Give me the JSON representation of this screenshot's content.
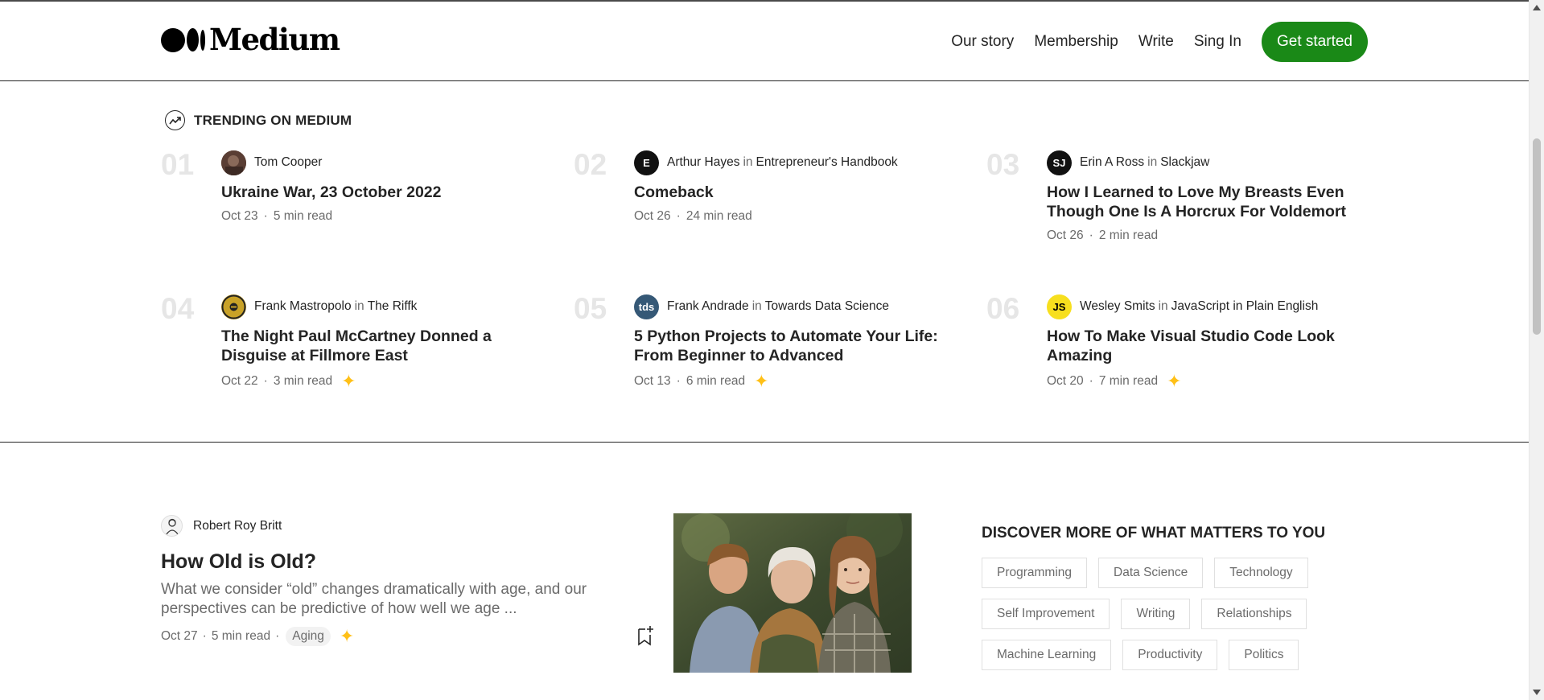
{
  "header": {
    "logo_text": "Medium",
    "nav": [
      "Our story",
      "Membership",
      "Write",
      "Sing In"
    ],
    "cta": "Get started",
    "accent_color": "#1a8917"
  },
  "trending": {
    "heading": "TRENDING ON MEDIUM",
    "items": [
      {
        "num": "01",
        "author": "Tom Cooper",
        "in": "",
        "publication": "",
        "avatar_text": "",
        "avatar_color": "#6b4a3a",
        "title": "Ukraine War, 23 October 2022",
        "date": "Oct 23",
        "read": "5 min read",
        "member_only": false
      },
      {
        "num": "02",
        "author": "Arthur Hayes",
        "in": "in",
        "publication": "Entrepreneur's Handbook",
        "avatar_text": "E",
        "avatar_color": "#111111",
        "title": "Comeback",
        "date": "Oct 26",
        "read": "24 min read",
        "member_only": false
      },
      {
        "num": "03",
        "author": "Erin A Ross",
        "in": "in",
        "publication": "Slackjaw",
        "avatar_text": "SJ",
        "avatar_color": "#111111",
        "title": "How I Learned to Love My Breasts Even Though One Is A Horcrux For Voldemort",
        "date": "Oct 26",
        "read": "2 min read",
        "member_only": false
      },
      {
        "num": "04",
        "author": "Frank Mastropolo",
        "in": "in",
        "publication": "The Riffk",
        "avatar_text": "",
        "avatar_color": "#c9a227",
        "title": "The Night Paul McCartney Donned a Disguise at Fillmore East",
        "date": "Oct 22",
        "read": "3 min read",
        "member_only": true
      },
      {
        "num": "05",
        "author": "Frank Andrade",
        "in": "in",
        "publication": "Towards Data Science",
        "avatar_text": "tds",
        "avatar_color": "#355876",
        "title": "5 Python Projects to Automate Your Life: From Beginner to Advanced",
        "date": "Oct 13",
        "read": "6 min read",
        "member_only": true
      },
      {
        "num": "06",
        "author": "Wesley Smits",
        "in": "in",
        "publication": "JavaScript in Plain English",
        "avatar_text": "JS",
        "avatar_color": "#f7df1e",
        "title": "How To Make Visual Studio Code Look Amazing",
        "date": "Oct 20",
        "read": "7 min read",
        "member_only": true
      }
    ]
  },
  "article": {
    "author": "Robert Roy Britt",
    "title": "How Old is Old?",
    "snippet": "What we consider “old” changes dramatically with age, and our perspectives can be predictive of how well we age ...",
    "date": "Oct 27",
    "read": "5 min read",
    "tag": "Aging",
    "member_only": true
  },
  "discover": {
    "heading": "DISCOVER MORE OF WHAT MATTERS TO YOU",
    "topics": [
      "Programming",
      "Data Science",
      "Technology",
      "Self Improvement",
      "Writing",
      "Relationships",
      "Machine Learning",
      "Productivity",
      "Politics"
    ]
  },
  "colors": {
    "member_star": "#ffc017",
    "muted_text": "#6b6b6b",
    "rank_number": "#e6e6e6"
  },
  "icons": {
    "trending": "trending-up-icon",
    "member": "star-icon",
    "bookmark": "bookmark-add-icon"
  }
}
